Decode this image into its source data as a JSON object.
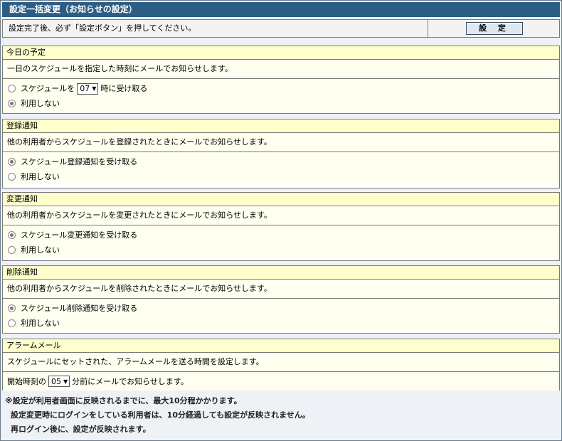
{
  "window": {
    "title": "設定一括変更（お知らせの設定）"
  },
  "topbar": {
    "message": "設定完了後、必ず「設定ボタン」を押してください。",
    "set_button": "設 定"
  },
  "sections": [
    {
      "header": "今日の予定",
      "description": "一日のスケジュールを指定した時刻にメールでお知らせします。",
      "option1_prefix": "スケジュールを",
      "option1_select": "07",
      "option1_suffix": "時に受け取る",
      "option2": "利用しない"
    },
    {
      "header": "登録通知",
      "description": "他の利用者からスケジュールを登録されたときにメールでお知らせします。",
      "option1": "スケジュール登録通知を受け取る",
      "option2": "利用しない"
    },
    {
      "header": "変更通知",
      "description": "他の利用者からスケジュールを変更されたときにメールでお知らせします。",
      "option1": "スケジュール変更通知を受け取る",
      "option2": "利用しない"
    },
    {
      "header": "削除通知",
      "description": "他の利用者からスケジュールを削除されたときにメールでお知らせします。",
      "option1": "スケジュール削除通知を受け取る",
      "option2": "利用しない"
    },
    {
      "header": "アラームメール",
      "description": "スケジュールにセットされた、アラームメールを送る時間を設定します。",
      "prefix": "開始時刻の",
      "select": "05",
      "suffix": "分前にメールでお知らせします。"
    }
  ],
  "notes": [
    "※設定が利用者画面に反映されるまでに、最大10分程かかります。",
    "設定変更時にログインをしている利用者は、10分経過しても設定が反映されません。",
    "再ログイン後に、設定が反映されます。"
  ]
}
